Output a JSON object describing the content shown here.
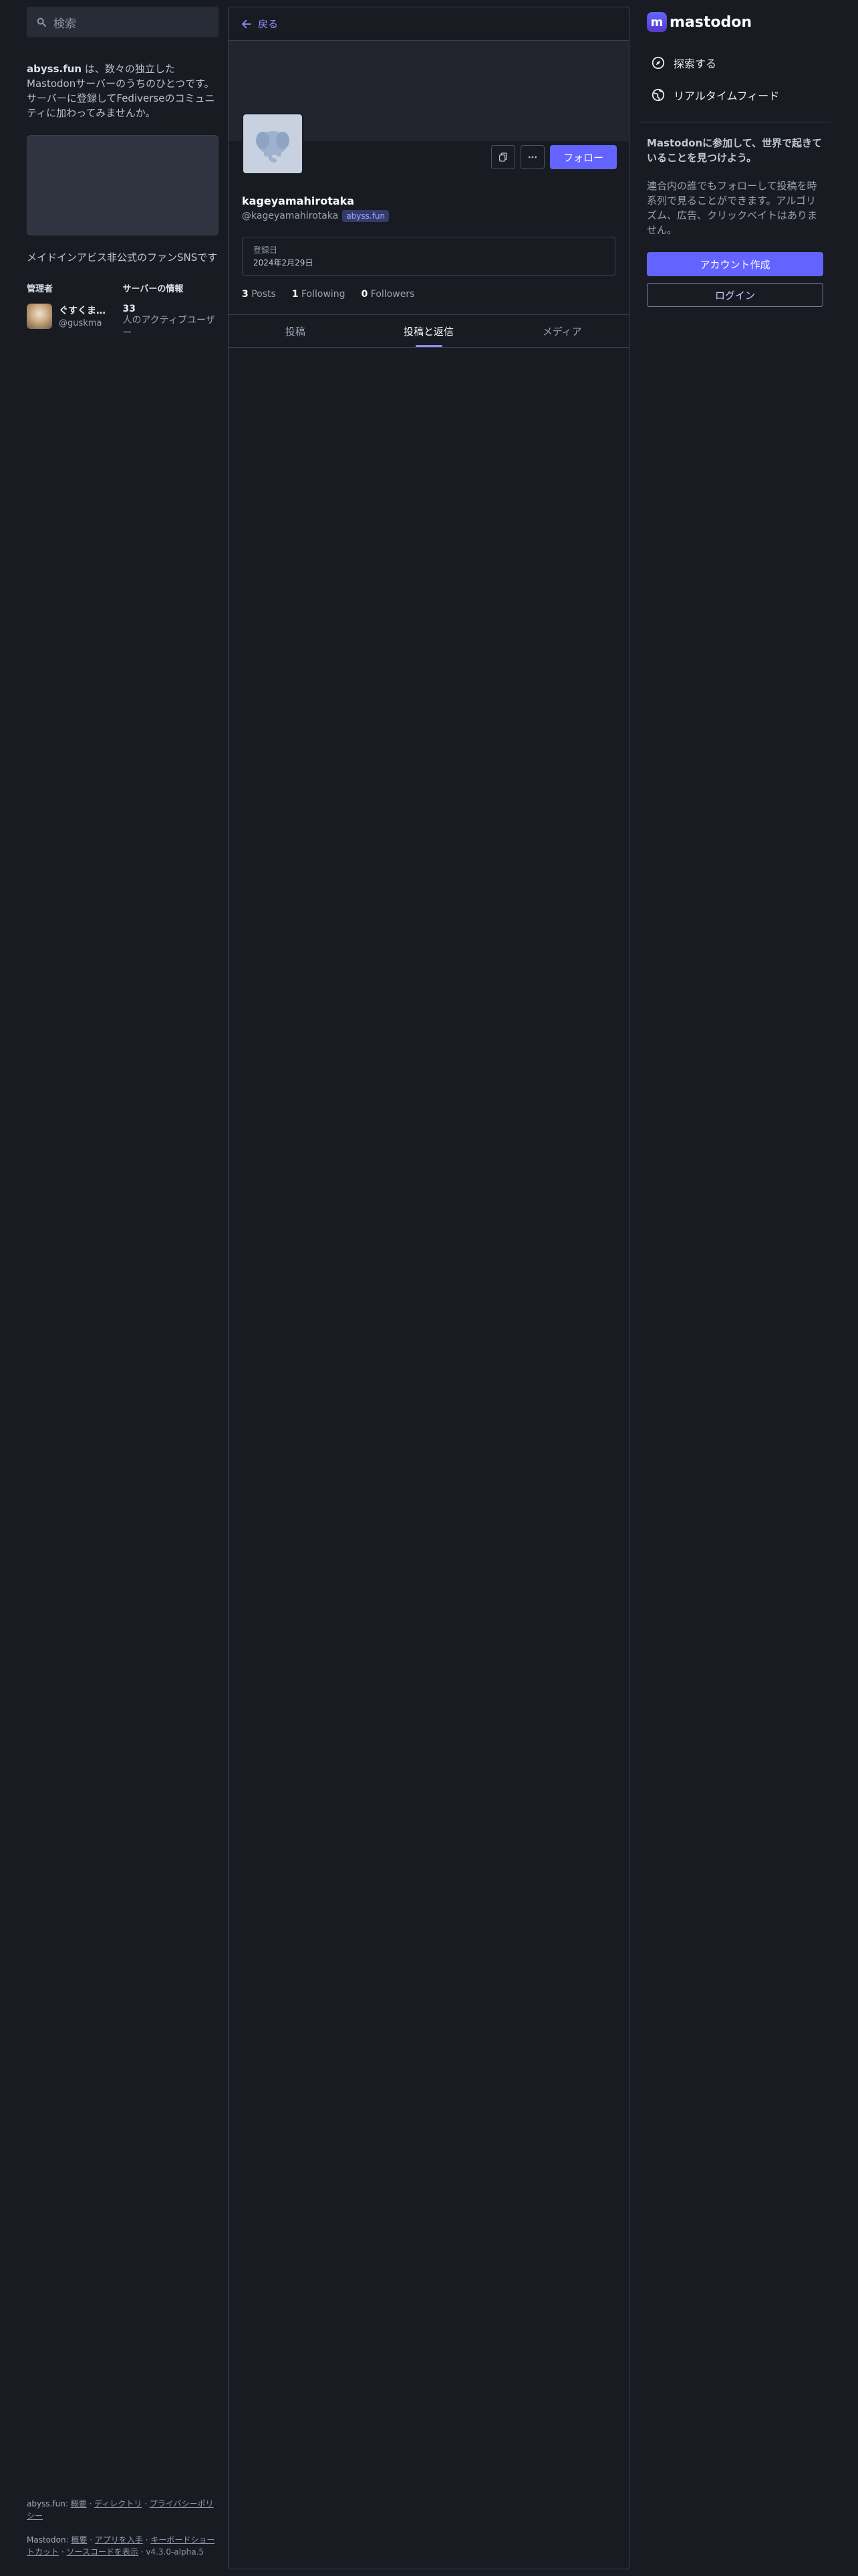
{
  "search": {
    "placeholder": "検索"
  },
  "about": {
    "server": "abyss.fun",
    "text": " は、数々の独立したMastodonサーバーのうちのひとつです。サーバーに登録してFediverseのコミュニティに加わってみませんか。",
    "tagline": "メイドインアビス非公式のファンSNSです"
  },
  "admin": {
    "heading": "管理者",
    "name": "ぐすくま@...",
    "handle": "@guskma"
  },
  "server_info": {
    "heading": "サーバーの情報",
    "count": "33",
    "label": "人のアクティブユーザー"
  },
  "footer": {
    "server": "abyss.fun",
    "links1": [
      "概要",
      "ディレクトリ",
      "プライバシーポリシー"
    ],
    "brand": "Mastodon",
    "links2": [
      "概要",
      "アプリを入手",
      "キーボードショートカット",
      "ソースコードを表示"
    ],
    "version": "v4.3.0-alpha.5"
  },
  "profile": {
    "back_label": "戻る",
    "display_name": "kageyamahirotaka",
    "acct": "@kageyamahirotaka",
    "domain": "abyss.fun",
    "follow_label": "フォロー",
    "joined_label": "登録日",
    "joined_value": "2024年2月29日",
    "posts_count": "3",
    "posts_label": "Posts",
    "following_count": "1",
    "following_label": "Following",
    "followers_count": "0",
    "followers_label": "Followers",
    "tabs": [
      "投稿",
      "投稿と返信",
      "メディア"
    ],
    "active_tab": 1
  },
  "nav": {
    "logo": "mastodon",
    "explore": "探索する",
    "live_feeds": "リアルタイムフィード"
  },
  "join": {
    "heading": "Mastodonに参加して、世界で起きていることを見つけよう。",
    "text": "連合内の誰でもフォローして投稿を時系列で見ることができます。アルゴリズム、広告、クリックベイトはありません。",
    "signup": "アカウント作成",
    "login": "ログイン"
  },
  "colors": {
    "accent": "#6364ff",
    "background": "#191b22"
  }
}
